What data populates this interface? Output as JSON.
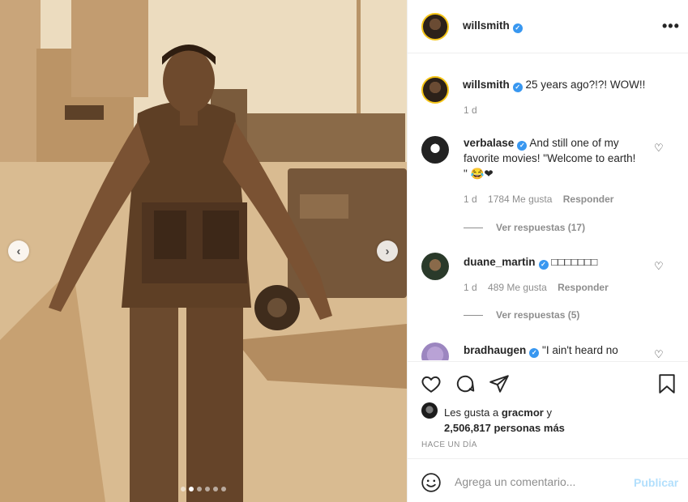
{
  "post": {
    "author": "willsmith",
    "caption": "25 years ago?!?! WOW!!",
    "caption_time": "1 d",
    "likes_prefix": "Les gusta a",
    "likes_user": "gracmor",
    "likes_connector": "y",
    "likes_count": "2,506,817",
    "likes_suffix": "personas más",
    "time_ago": "HACE UN DÍA"
  },
  "photo": {
    "carousel_total": 6,
    "carousel_active_index": 1
  },
  "comments": [
    {
      "user": "verbalase",
      "verified": true,
      "text": "And still one of my favorite movies! \"Welcome to earth! \" 😂❤",
      "time": "1 d",
      "likes": "1784 Me gusta",
      "reply_label": "Responder",
      "view_replies": "Ver respuestas (17)"
    },
    {
      "user": "duane_martin",
      "verified": true,
      "text": "□□□□□□□",
      "time": "1 d",
      "likes": "489 Me gusta",
      "reply_label": "Responder",
      "view_replies": "Ver respuestas (5)"
    },
    {
      "user": "bradhaugen",
      "verified": true,
      "text": "\"I ain't heard no"
    }
  ],
  "add_comment": {
    "placeholder": "Agrega un comentario...",
    "publish_label": "Publicar"
  },
  "icons": {
    "more": "more-options-icon",
    "like": "heart-icon",
    "comment": "comment-icon",
    "share": "share-icon",
    "save": "bookmark-icon",
    "emoji": "emoji-icon"
  },
  "colors": {
    "verified": "#3897f0",
    "muted": "#8e8e8e",
    "publish_disabled": "#b2dffc",
    "avatar_ring": "#f5c518"
  }
}
